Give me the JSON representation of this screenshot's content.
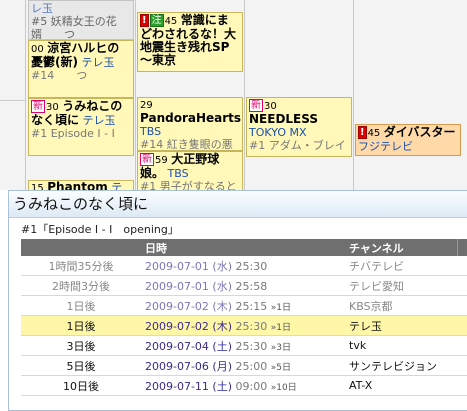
{
  "grid": {
    "cells": [
      {
        "id": "p1",
        "l1": "レ玉",
        "l2": "#5 妖精女王の花",
        "l3": "婿　　つ"
      },
      {
        "id": "p2",
        "num": "00",
        "title": "涼宮ハルヒの憂鬱(新)",
        "ch": "テレ玉",
        "sub": "#14　　つ"
      },
      {
        "id": "p3",
        "warn": "!",
        "note": "注",
        "num": "45",
        "title": "常識にまどわされるな！大地震生き残れSP～東京"
      },
      {
        "id": "p4",
        "new": "新",
        "num": "30",
        "title": "うみねこのなく頃に",
        "ch": "テレ玉",
        "sub": "#1 Episode I - I"
      },
      {
        "id": "p5",
        "num": "29",
        "title": "PandoraHearts",
        "ch": "TBS",
        "sub": "#14 紅き隻眼の悪"
      },
      {
        "id": "p6",
        "new": "新",
        "num": "59",
        "title": "大正野球娘。",
        "ch": "TBS",
        "sub": "#1 男子がすなると"
      },
      {
        "id": "p7",
        "new": "新",
        "num": "30",
        "title": "NEEDLESS",
        "ch": "TOKYO MX",
        "sub": "#1 アダム・ブレイ"
      },
      {
        "id": "p8",
        "warn": "!",
        "num": "45",
        "title": "ダイバスター",
        "ch": "フジテレビ"
      },
      {
        "id": "p9",
        "num": "15",
        "title": "Phantom",
        "ch": "テレ"
      }
    ]
  },
  "popup": {
    "title": "うみねこのなく頃に",
    "episode": "#1「Episode I - I　opening」",
    "headers": {
      "rel": "",
      "date": "日時",
      "channel": "チャンネル"
    },
    "rows": [
      {
        "rel": "1時間35分後",
        "date": "2009-07-01",
        "dow": "水",
        "time": "25:30",
        "flag": "",
        "channel": "チバテレビ",
        "state": "past"
      },
      {
        "rel": "2時間3分後",
        "date": "2009-07-01",
        "dow": "水",
        "time": "25:58",
        "flag": "",
        "channel": "テレビ愛知",
        "state": "past"
      },
      {
        "rel": "1日後",
        "date": "2009-07-02",
        "dow": "木",
        "time": "25:15",
        "flag": "»1日",
        "channel": "KBS京都",
        "state": "past"
      },
      {
        "rel": "1日後",
        "date": "2009-07-02",
        "dow": "木",
        "time": "25:30",
        "flag": "»1日",
        "channel": "テレ玉",
        "state": "current"
      },
      {
        "rel": "3日後",
        "date": "2009-07-04",
        "dow": "土",
        "time": "25:30",
        "flag": "»3日",
        "channel": "tvk",
        "state": "normal"
      },
      {
        "rel": "5日後",
        "date": "2009-07-06",
        "dow": "月",
        "time": "25:00",
        "flag": "»5日",
        "channel": "サンテレビジョン",
        "state": "normal"
      },
      {
        "rel": "10日後",
        "date": "2009-07-11",
        "dow": "土",
        "time": "09:00",
        "flag": "»10日",
        "channel": "AT-X",
        "state": "normal"
      }
    ]
  }
}
